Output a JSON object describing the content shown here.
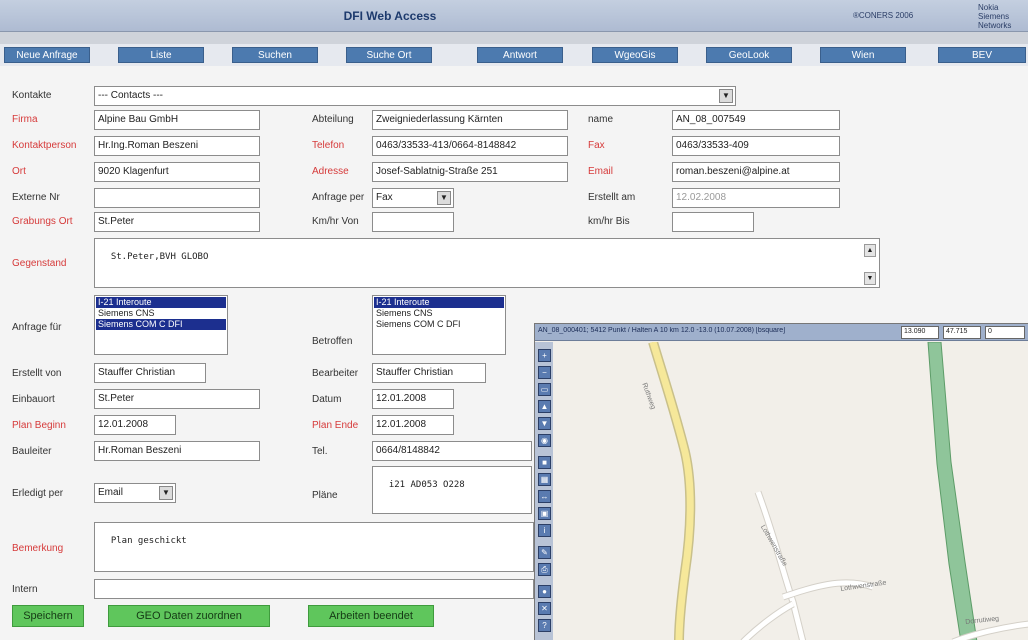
{
  "header": {
    "title": "DFI Web Access",
    "copyright": "®CONERS 2006",
    "vendor": "Nokia Siemens\nNetworks"
  },
  "nav": {
    "items": [
      "Neue Anfrage",
      "Liste",
      "Suchen",
      "Suche Ort",
      "Antwort",
      "WgeoGis",
      "GeoLook",
      "Wien",
      "BEV"
    ]
  },
  "form": {
    "kontakte": {
      "label": "Kontakte",
      "value": "--- Contacts ---"
    },
    "firma": {
      "label": "Firma",
      "value": "Alpine Bau GmbH"
    },
    "abteilung": {
      "label": "Abteilung",
      "value": "Zweigniederlassung Kärnten"
    },
    "name": {
      "label": "name",
      "value": "AN_08_007549"
    },
    "kontaktperson": {
      "label": "Kontaktperson",
      "value": "Hr.Ing.Roman Beszeni"
    },
    "telefon": {
      "label": "Telefon",
      "value": "0463/33533-413/0664-8148842"
    },
    "fax": {
      "label": "Fax",
      "value": "0463/33533-409"
    },
    "ort": {
      "label": "Ort",
      "value": "9020 Klagenfurt"
    },
    "adresse": {
      "label": "Adresse",
      "value": "Josef-Sablatnig-Straße 251"
    },
    "email": {
      "label": "Email",
      "value": "roman.beszeni@alpine.at"
    },
    "externe_nr": {
      "label": "Externe Nr",
      "value": ""
    },
    "anfrage_per": {
      "label": "Anfrage per",
      "value": "Fax"
    },
    "erstellt_am": {
      "label": "Erstellt am",
      "value": "12.02.2008"
    },
    "grabungs_ort": {
      "label": "Grabungs Ort",
      "value": "St.Peter"
    },
    "kmhr_von": {
      "label": "Km/hr Von",
      "value": ""
    },
    "kmhr_bis": {
      "label": "km/hr Bis",
      "value": ""
    },
    "gegenstand": {
      "label": "Gegenstand",
      "value": "St.Peter,BVH GLOBO"
    },
    "anfrage_fuer": {
      "label": "Anfrage für",
      "options": [
        "I-21 Interoute",
        "Siemens CNS",
        "Siemens COM C DFI"
      ],
      "selected": [
        true,
        false,
        true
      ]
    },
    "betroffen": {
      "label": "Betroffen",
      "options": [
        "I-21 Interoute",
        "Siemens CNS",
        "Siemens COM C DFI"
      ],
      "selected": [
        true,
        false,
        false
      ]
    },
    "erstellt_von": {
      "label": "Erstellt von",
      "value": "Stauffer Christian"
    },
    "bearbeiter": {
      "label": "Bearbeiter",
      "value": "Stauffer Christian"
    },
    "einbauort": {
      "label": "Einbauort",
      "value": "St.Peter"
    },
    "datum": {
      "label": "Datum",
      "value": "12.01.2008"
    },
    "plan_beginn": {
      "label": "Plan Beginn",
      "value": "12.01.2008"
    },
    "plan_ende": {
      "label": "Plan Ende",
      "value": "12.01.2008"
    },
    "bauleiter": {
      "label": "Bauleiter",
      "value": "Hr.Roman Beszeni"
    },
    "tel": {
      "label": "Tel.",
      "value": "0664/8148842"
    },
    "erledigt_per": {
      "label": "Erledigt per",
      "value": "Email"
    },
    "plaene": {
      "label": "Pläne",
      "value": "i21 AD053 O228"
    },
    "bemerkung": {
      "label": "Bemerkung",
      "value": "Plan geschickt"
    },
    "intern": {
      "label": "Intern",
      "value": ""
    }
  },
  "actions": {
    "save": "Speichern",
    "geo": "GEO Daten zuordnen",
    "finish": "Arbeiten beendet"
  },
  "map": {
    "title": "AN_08_000401; 5412 Punkt / Halten A 10 km 12.0 -13.0 (10.07.2008) [bsquare]",
    "coord1": "13.090",
    "coord2": "47.715",
    "coord3": "0",
    "street1": "Ruthweg",
    "street2": "Lothwenstraße",
    "street3": "Lothwenstraße",
    "street4": "Dorrutiweg"
  },
  "colors": {
    "nav_button": "#4c7aaf",
    "action_button": "#5fc65c",
    "required_label": "#d63a3a",
    "selected_option": "#1c2f8f"
  }
}
